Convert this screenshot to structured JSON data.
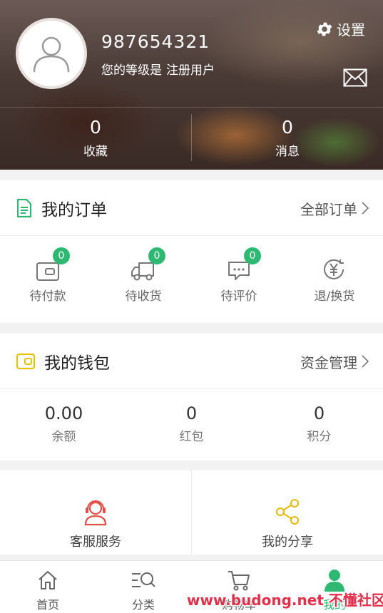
{
  "profile": {
    "username": "987654321",
    "level_prefix": "您的等级是",
    "level_value": "注册用户",
    "settings_label": "设置",
    "stats": [
      {
        "value": "0",
        "label": "收藏"
      },
      {
        "value": "0",
        "label": "消息"
      }
    ]
  },
  "orders": {
    "title": "我的订单",
    "link": "全部订单",
    "items": [
      {
        "label": "待付款",
        "badge": "0",
        "icon": "wallet-icon"
      },
      {
        "label": "待收货",
        "badge": "0",
        "icon": "truck-icon"
      },
      {
        "label": "待评价",
        "badge": "0",
        "icon": "comment-icon"
      },
      {
        "label": "退/换货",
        "icon": "yen-refund-icon"
      }
    ]
  },
  "wallet": {
    "title": "我的钱包",
    "link": "资金管理",
    "items": [
      {
        "value": "0.00",
        "label": "余额"
      },
      {
        "value": "0",
        "label": "红包"
      },
      {
        "value": "0",
        "label": "积分"
      }
    ]
  },
  "services": [
    {
      "label": "客服服务",
      "icon": "customer-service-icon"
    },
    {
      "label": "我的分享",
      "icon": "share-icon"
    }
  ],
  "tabbar": [
    {
      "label": "首页",
      "icon": "home-icon"
    },
    {
      "label": "分类",
      "icon": "category-search-icon"
    },
    {
      "label": "购物车",
      "icon": "cart-icon"
    },
    {
      "label": "我的",
      "icon": "user-icon"
    }
  ],
  "watermark": "www.budong.net 不懂社区",
  "colors": {
    "accent": "#2eb872",
    "order_icon": "#2eb872",
    "wallet_icon": "#e6c200",
    "service_icon": "#e0504a",
    "share_icon": "#e6b800"
  }
}
